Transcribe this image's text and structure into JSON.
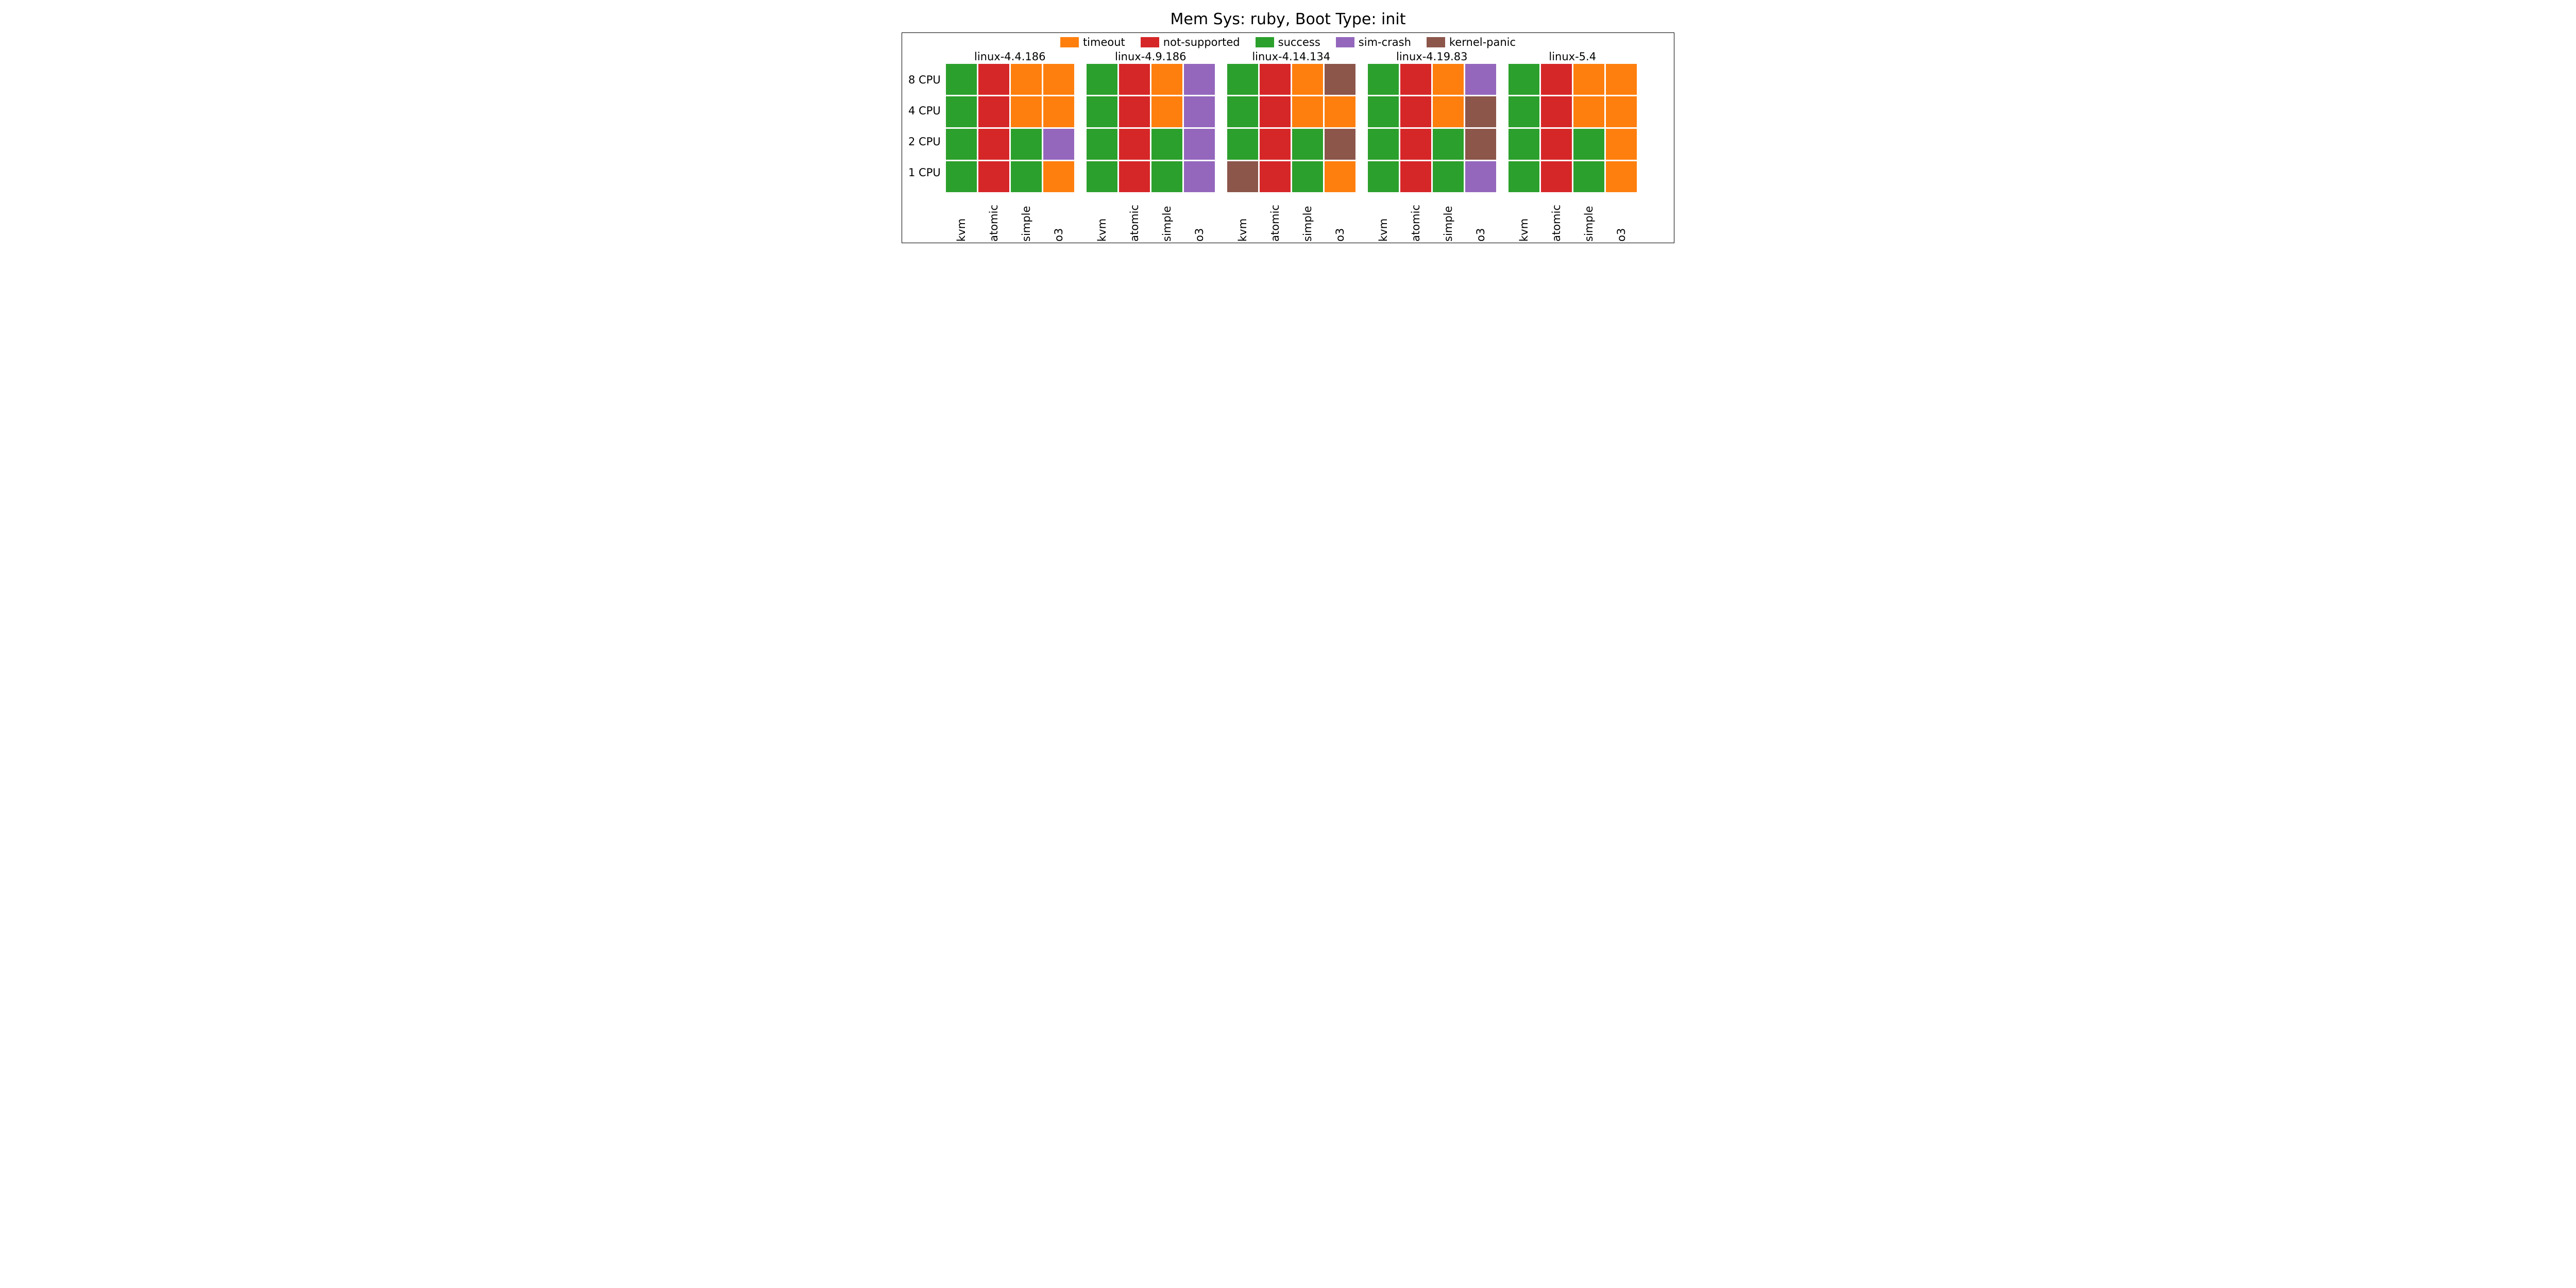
{
  "title": "Mem Sys: ruby, Boot Type: init",
  "legend": [
    {
      "label": "timeout",
      "color": "#ff7f0e"
    },
    {
      "label": "not-supported",
      "color": "#d62728"
    },
    {
      "label": "success",
      "color": "#2ca02c"
    },
    {
      "label": "sim-crash",
      "color": "#9467bd"
    },
    {
      "label": "kernel-panic",
      "color": "#8c564b"
    }
  ],
  "y_categories": [
    "8 CPU",
    "4 CPU",
    "2 CPU",
    "1 CPU"
  ],
  "x_categories": [
    "kvm",
    "atomic",
    "simple",
    "o3"
  ],
  "panels": [
    {
      "title": "linux-4.4.186",
      "grid": [
        [
          "success",
          "not-supported",
          "timeout",
          "timeout"
        ],
        [
          "success",
          "not-supported",
          "timeout",
          "timeout"
        ],
        [
          "success",
          "not-supported",
          "success",
          "sim-crash"
        ],
        [
          "success",
          "not-supported",
          "success",
          "timeout"
        ]
      ]
    },
    {
      "title": "linux-4.9.186",
      "grid": [
        [
          "success",
          "not-supported",
          "timeout",
          "sim-crash"
        ],
        [
          "success",
          "not-supported",
          "timeout",
          "sim-crash"
        ],
        [
          "success",
          "not-supported",
          "success",
          "sim-crash"
        ],
        [
          "success",
          "not-supported",
          "success",
          "sim-crash"
        ]
      ]
    },
    {
      "title": "linux-4.14.134",
      "grid": [
        [
          "success",
          "not-supported",
          "timeout",
          "kernel-panic"
        ],
        [
          "success",
          "not-supported",
          "timeout",
          "timeout"
        ],
        [
          "success",
          "not-supported",
          "success",
          "kernel-panic"
        ],
        [
          "kernel-panic",
          "not-supported",
          "success",
          "timeout"
        ]
      ]
    },
    {
      "title": "linux-4.19.83",
      "grid": [
        [
          "success",
          "not-supported",
          "timeout",
          "sim-crash"
        ],
        [
          "success",
          "not-supported",
          "timeout",
          "kernel-panic"
        ],
        [
          "success",
          "not-supported",
          "success",
          "kernel-panic"
        ],
        [
          "success",
          "not-supported",
          "success",
          "sim-crash"
        ]
      ]
    },
    {
      "title": "linux-5.4",
      "grid": [
        [
          "success",
          "not-supported",
          "timeout",
          "timeout"
        ],
        [
          "success",
          "not-supported",
          "timeout",
          "timeout"
        ],
        [
          "success",
          "not-supported",
          "success",
          "timeout"
        ],
        [
          "success",
          "not-supported",
          "success",
          "timeout"
        ]
      ]
    }
  ],
  "chart_data": {
    "type": "heatmap",
    "title": "Mem Sys: ruby, Boot Type: init",
    "subplots": [
      "linux-4.4.186",
      "linux-4.9.186",
      "linux-4.14.134",
      "linux-4.19.83",
      "linux-5.4"
    ],
    "x": [
      "kvm",
      "atomic",
      "simple",
      "o3"
    ],
    "y": [
      "8 CPU",
      "4 CPU",
      "2 CPU",
      "1 CPU"
    ],
    "categories": [
      "timeout",
      "not-supported",
      "success",
      "sim-crash",
      "kernel-panic"
    ],
    "colors": {
      "timeout": "#ff7f0e",
      "not-supported": "#d62728",
      "success": "#2ca02c",
      "sim-crash": "#9467bd",
      "kernel-panic": "#8c564b"
    },
    "data": {
      "linux-4.4.186": [
        [
          "success",
          "not-supported",
          "timeout",
          "timeout"
        ],
        [
          "success",
          "not-supported",
          "timeout",
          "timeout"
        ],
        [
          "success",
          "not-supported",
          "success",
          "sim-crash"
        ],
        [
          "success",
          "not-supported",
          "success",
          "timeout"
        ]
      ],
      "linux-4.9.186": [
        [
          "success",
          "not-supported",
          "timeout",
          "sim-crash"
        ],
        [
          "success",
          "not-supported",
          "timeout",
          "sim-crash"
        ],
        [
          "success",
          "not-supported",
          "success",
          "sim-crash"
        ],
        [
          "success",
          "not-supported",
          "success",
          "sim-crash"
        ]
      ],
      "linux-4.14.134": [
        [
          "success",
          "not-supported",
          "timeout",
          "kernel-panic"
        ],
        [
          "success",
          "not-supported",
          "timeout",
          "timeout"
        ],
        [
          "success",
          "not-supported",
          "success",
          "kernel-panic"
        ],
        [
          "kernel-panic",
          "not-supported",
          "success",
          "timeout"
        ]
      ],
      "linux-4.19.83": [
        [
          "success",
          "not-supported",
          "timeout",
          "sim-crash"
        ],
        [
          "success",
          "not-supported",
          "timeout",
          "kernel-panic"
        ],
        [
          "success",
          "not-supported",
          "success",
          "kernel-panic"
        ],
        [
          "success",
          "not-supported",
          "success",
          "sim-crash"
        ]
      ],
      "linux-5.4": [
        [
          "success",
          "not-supported",
          "timeout",
          "timeout"
        ],
        [
          "success",
          "not-supported",
          "timeout",
          "timeout"
        ],
        [
          "success",
          "not-supported",
          "success",
          "timeout"
        ],
        [
          "success",
          "not-supported",
          "success",
          "timeout"
        ]
      ]
    }
  }
}
